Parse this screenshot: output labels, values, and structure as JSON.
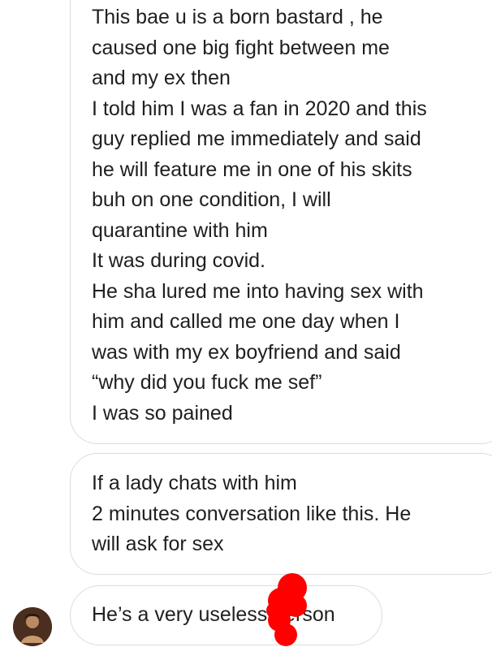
{
  "messages": [
    {
      "lines": [
        "This bae u is a born bastard , he",
        "caused one big fight between me",
        "and my ex then",
        "I told him I was a fan in 2020 and this",
        "guy replied me immediately and said",
        "he will feature me in one of his skits",
        "buh on one condition, I will",
        "quarantine with him",
        "It was during covid.",
        "He sha lured me into having sex with",
        "him and called me one day when I",
        "was with my ex boyfriend and said",
        "“why did you fuck me sef”",
        "I was so pained"
      ]
    },
    {
      "lines": [
        "If a lady chats with him",
        "2 minutes conversation like this.  He",
        "will ask for sex"
      ]
    },
    {
      "lines": [
        "He’s a very useless person"
      ]
    }
  ],
  "sender_avatar_icon": "profile-photo-avatar",
  "redaction_mark_color": "#ff0000"
}
